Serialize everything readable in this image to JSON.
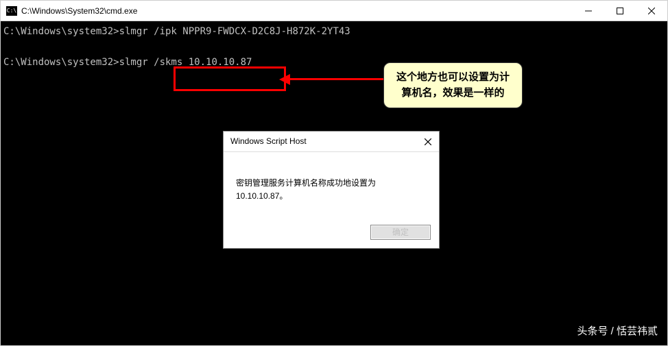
{
  "window": {
    "icon_text": "C:\\",
    "title": "C:\\Windows\\System32\\cmd.exe"
  },
  "terminal": {
    "line1_prompt": "C:\\Windows\\system32>",
    "line1_cmd": "slmgr /ipk NPPR9-FWDCX-D2C8J-H872K-2YT43",
    "line2_prompt": "C:\\Windows\\system32>",
    "line2_cmd_a": "slmgr /skms ",
    "line2_cmd_b": "10.10.10.87"
  },
  "annotation": {
    "callout_line1": "这个地方也可以设置为计",
    "callout_line2": "算机名，效果是一样的"
  },
  "dialog": {
    "title": "Windows Script Host",
    "message": "密钥管理服务计算机名称成功地设置为 10.10.10.87。",
    "ok_label": "确定"
  },
  "watermark": "头条号 / 恬芸祎贰"
}
